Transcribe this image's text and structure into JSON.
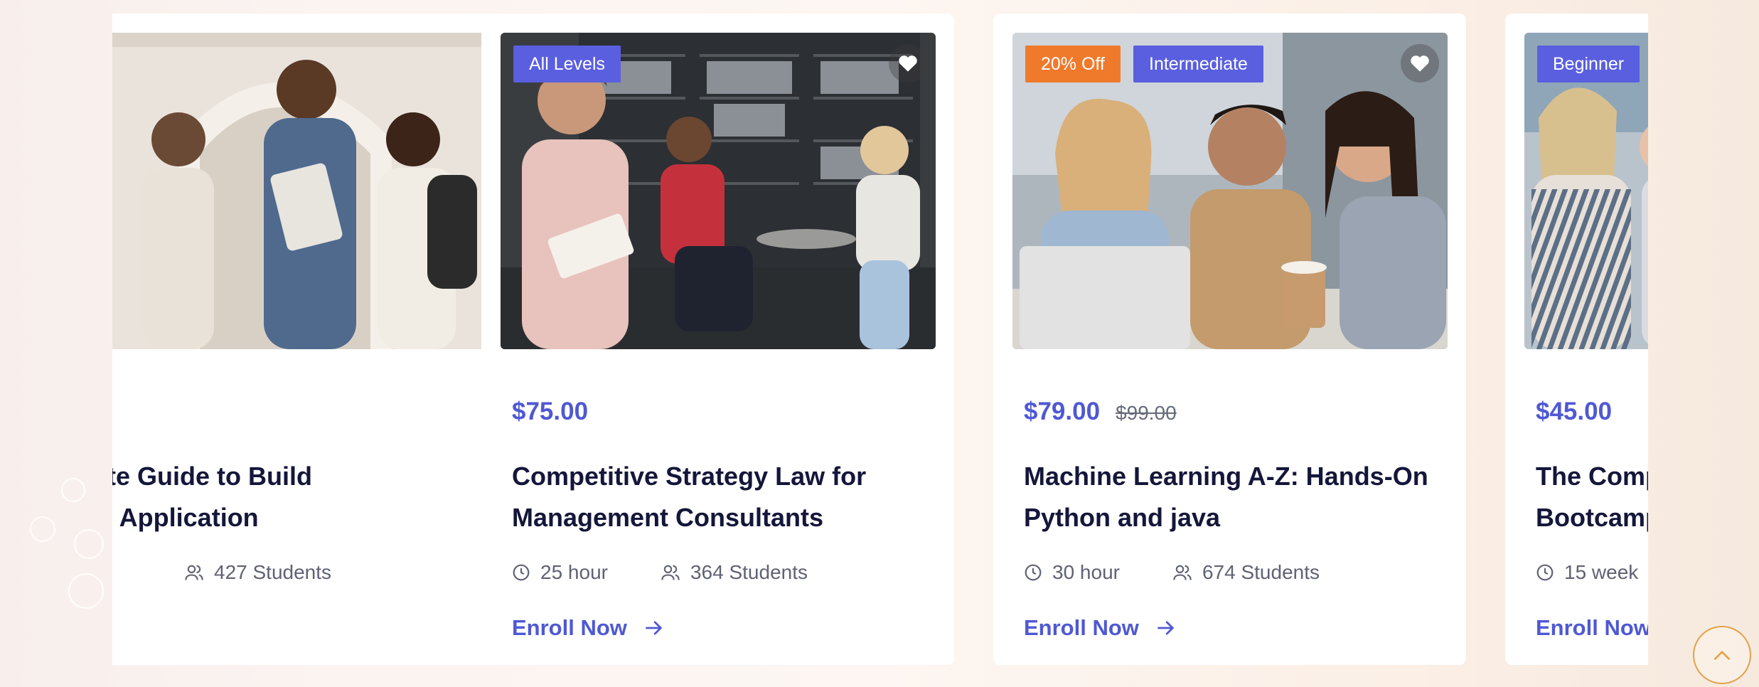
{
  "colors": {
    "accent": "#4f59d3",
    "badge_level": "#5a5fe0",
    "badge_discount": "#ef7a2c",
    "heading": "#14163a",
    "muted": "#5e6273",
    "scroll_ring": "#e2a24a"
  },
  "icons": {
    "favorite": "heart-icon",
    "duration": "clock-icon",
    "students": "users-icon",
    "enroll": "arrow-right-icon",
    "scroll_top": "chevron-up-icon"
  },
  "courses": [
    {
      "price": "",
      "title_line1": "plete Guide to Build",
      "title_line2": "API Application",
      "duration": "",
      "students": "427 Students",
      "enroll_label": ""
    },
    {
      "badge": "All Levels",
      "price": "$75.00",
      "title_line1": "Competitive Strategy Law for",
      "title_line2": "Management Consultants",
      "duration": "25 hour",
      "students": "364 Students",
      "enroll_label": "Enroll Now"
    },
    {
      "discount_badge": "20% Off",
      "badge": "Intermediate",
      "price": "$79.00",
      "old_price": "$99.00",
      "title_line1": "Machine Learning A-Z: Hands-On",
      "title_line2": "Python and java",
      "duration": "30 hour",
      "students": "674 Students",
      "enroll_label": "Enroll Now"
    },
    {
      "badge": "Beginner",
      "price": "$45.00",
      "title_line1": "The Comp",
      "title_line2": "Bootcamp",
      "duration": "15 week",
      "enroll_label": "Enroll Now"
    }
  ]
}
